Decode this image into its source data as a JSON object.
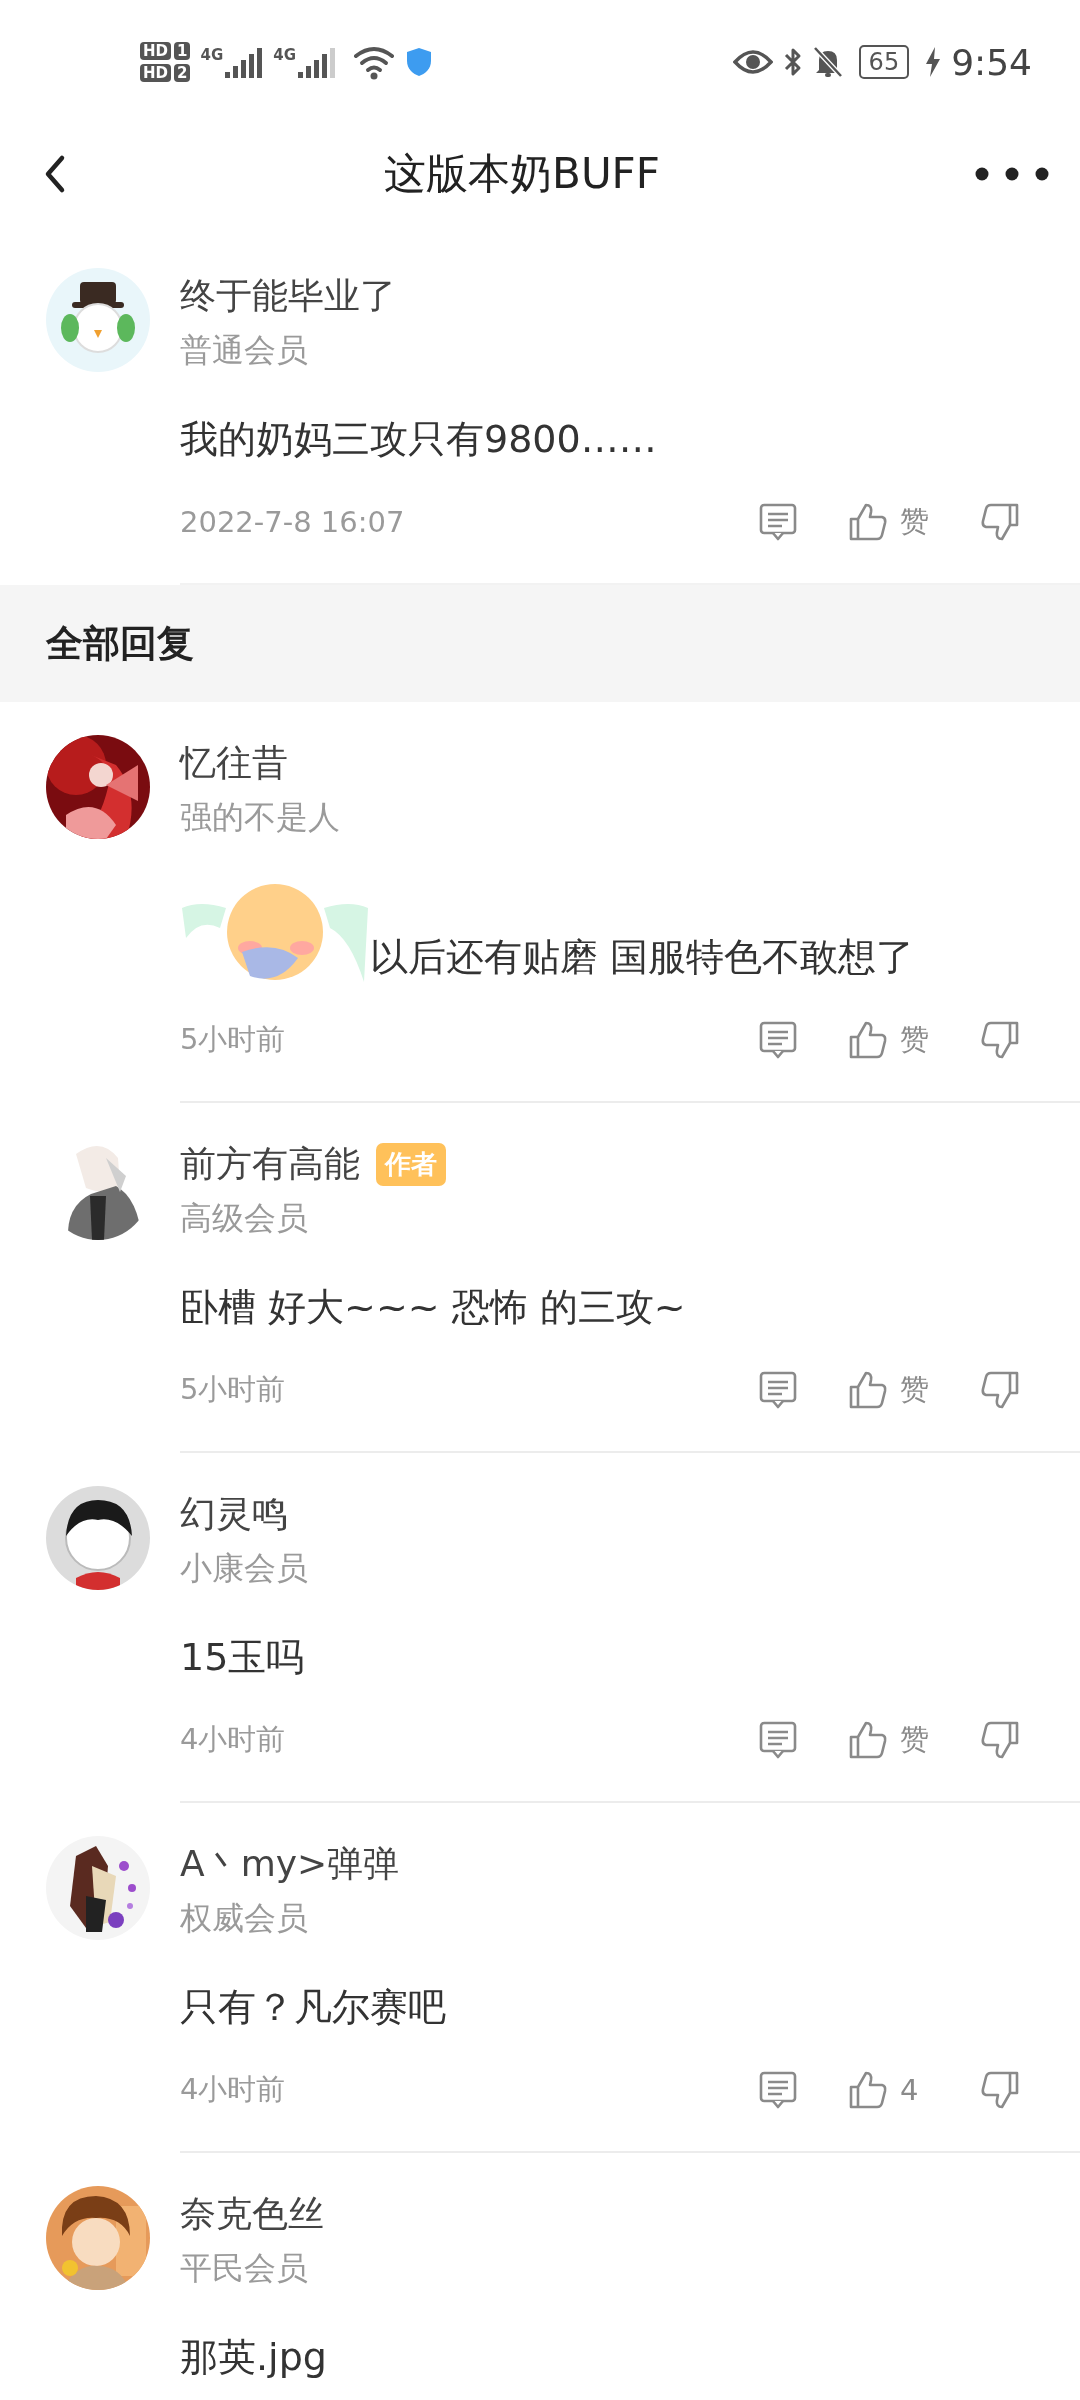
{
  "status_bar": {
    "sims": [
      {
        "label": "HD",
        "slot": "1"
      },
      {
        "label": "HD",
        "slot": "2"
      }
    ],
    "networks": [
      "4G",
      "4G"
    ],
    "battery": "65",
    "charging": true,
    "time": "9:54"
  },
  "nav": {
    "title": "这版本奶BUFF"
  },
  "post": {
    "author": "终于能毕业了",
    "rank": "普通会员",
    "text": "我的奶妈三攻只有9800……",
    "time": "2022-7-8 16:07",
    "like_label": "赞"
  },
  "replies": {
    "heading": "全部回复",
    "items": [
      {
        "author": "忆往昔",
        "rank": "强的不是人",
        "sticker": true,
        "text": "以后还有贴磨 国服特色不敢想了",
        "time": "5小时前",
        "like_label": "赞"
      },
      {
        "author": "前方有高能",
        "badge": "作者",
        "rank": "高级会员",
        "text": "卧槽 好大~~~ 恐怖 的三攻~",
        "time": "5小时前",
        "like_label": "赞"
      },
      {
        "author": "幻灵鸣",
        "rank": "小康会员",
        "text": "15玉吗",
        "time": "4小时前",
        "like_label": "赞"
      },
      {
        "author": "A丶my>弹弹",
        "rank": "权威会员",
        "text": "只有？凡尔赛吧",
        "time": "4小时前",
        "like_label": "4"
      },
      {
        "author": "奈克色丝",
        "rank": "平民会员",
        "text": "那英.jpg"
      }
    ]
  }
}
